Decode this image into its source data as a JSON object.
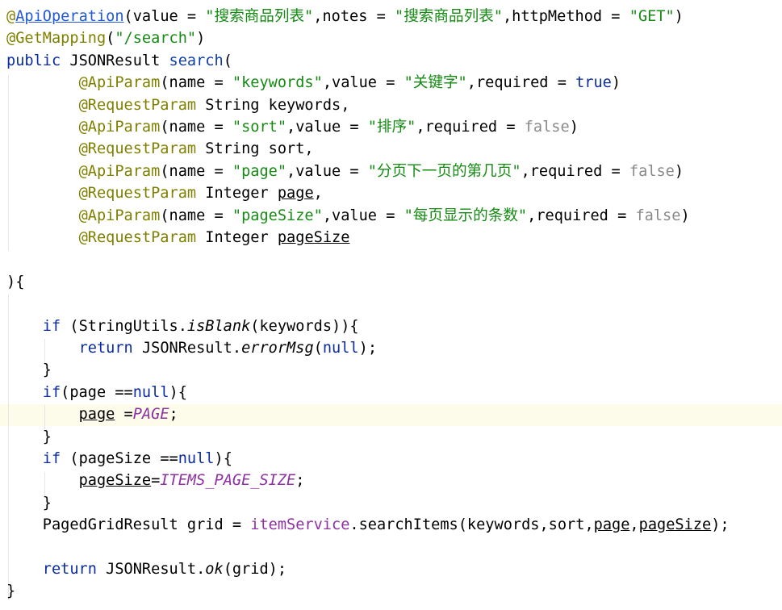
{
  "code": {
    "lines": [
      [
        {
          "t": "@",
          "c": "ann"
        },
        {
          "t": "ApiOperation",
          "c": "annu"
        },
        {
          "t": "(value = ",
          "c": ""
        },
        {
          "t": "\"搜索商品列表\"",
          "c": "str"
        },
        {
          "t": ",notes = ",
          "c": ""
        },
        {
          "t": "\"搜索商品列表\"",
          "c": "str"
        },
        {
          "t": ",httpMethod = ",
          "c": ""
        },
        {
          "t": "\"GET\"",
          "c": "str"
        },
        {
          "t": ")",
          "c": ""
        }
      ],
      [
        {
          "t": "@GetMapping",
          "c": "ann"
        },
        {
          "t": "(",
          "c": ""
        },
        {
          "t": "\"/search\"",
          "c": "str"
        },
        {
          "t": ")",
          "c": ""
        }
      ],
      [
        {
          "t": "public ",
          "c": "kw"
        },
        {
          "t": "JSONResult ",
          "c": ""
        },
        {
          "t": "search",
          "c": "meth"
        },
        {
          "t": "(",
          "c": ""
        }
      ],
      [
        {
          "t": "        ",
          "c": ""
        },
        {
          "t": "@ApiParam",
          "c": "ann"
        },
        {
          "t": "(name = ",
          "c": ""
        },
        {
          "t": "\"keywords\"",
          "c": "str"
        },
        {
          "t": ",value = ",
          "c": ""
        },
        {
          "t": "\"关键字\"",
          "c": "str"
        },
        {
          "t": ",required = ",
          "c": ""
        },
        {
          "t": "true",
          "c": "tru"
        },
        {
          "t": ")",
          "c": ""
        }
      ],
      [
        {
          "t": "        ",
          "c": ""
        },
        {
          "t": "@RequestParam ",
          "c": "ann"
        },
        {
          "t": "String keywords,",
          "c": ""
        }
      ],
      [
        {
          "t": "        ",
          "c": ""
        },
        {
          "t": "@ApiParam",
          "c": "ann"
        },
        {
          "t": "(name = ",
          "c": ""
        },
        {
          "t": "\"sort\"",
          "c": "str"
        },
        {
          "t": ",value = ",
          "c": ""
        },
        {
          "t": "\"排序\"",
          "c": "str"
        },
        {
          "t": ",required = ",
          "c": ""
        },
        {
          "t": "false",
          "c": "fal"
        },
        {
          "t": ")",
          "c": ""
        }
      ],
      [
        {
          "t": "        ",
          "c": ""
        },
        {
          "t": "@RequestParam ",
          "c": "ann"
        },
        {
          "t": "String sort,",
          "c": ""
        }
      ],
      [
        {
          "t": "        ",
          "c": ""
        },
        {
          "t": "@ApiParam",
          "c": "ann"
        },
        {
          "t": "(name = ",
          "c": ""
        },
        {
          "t": "\"page\"",
          "c": "str"
        },
        {
          "t": ",value = ",
          "c": ""
        },
        {
          "t": "\"分页下一页的第几页\"",
          "c": "str"
        },
        {
          "t": ",required = ",
          "c": ""
        },
        {
          "t": "false",
          "c": "fal"
        },
        {
          "t": ")",
          "c": ""
        }
      ],
      [
        {
          "t": "        ",
          "c": ""
        },
        {
          "t": "@RequestParam ",
          "c": "ann"
        },
        {
          "t": "Integer ",
          "c": ""
        },
        {
          "t": "page",
          "c": "ul"
        },
        {
          "t": ",",
          "c": ""
        }
      ],
      [
        {
          "t": "        ",
          "c": ""
        },
        {
          "t": "@ApiParam",
          "c": "ann"
        },
        {
          "t": "(name = ",
          "c": ""
        },
        {
          "t": "\"pageSize\"",
          "c": "str"
        },
        {
          "t": ",value = ",
          "c": ""
        },
        {
          "t": "\"每页显示的条数\"",
          "c": "str"
        },
        {
          "t": ",required = ",
          "c": ""
        },
        {
          "t": "false",
          "c": "fal"
        },
        {
          "t": ")",
          "c": ""
        }
      ],
      [
        {
          "t": "        ",
          "c": ""
        },
        {
          "t": "@RequestParam ",
          "c": "ann"
        },
        {
          "t": "Integer ",
          "c": ""
        },
        {
          "t": "pageSize",
          "c": "ul"
        }
      ],
      [],
      [
        {
          "t": "){",
          "c": ""
        }
      ],
      [],
      [
        {
          "t": "    ",
          "c": ""
        },
        {
          "t": "if ",
          "c": "kw"
        },
        {
          "t": "(StringUtils.",
          "c": ""
        },
        {
          "t": "isBlank",
          "c": "ital"
        },
        {
          "t": "(keywords)){",
          "c": ""
        }
      ],
      [
        {
          "t": "        ",
          "c": ""
        },
        {
          "t": "return ",
          "c": "kw"
        },
        {
          "t": "JSONResult.",
          "c": ""
        },
        {
          "t": "errorMsg",
          "c": "ital"
        },
        {
          "t": "(",
          "c": ""
        },
        {
          "t": "null",
          "c": "kw"
        },
        {
          "t": ");",
          "c": ""
        }
      ],
      [
        {
          "t": "    }",
          "c": ""
        }
      ],
      [
        {
          "t": "    ",
          "c": ""
        },
        {
          "t": "if",
          "c": "kw"
        },
        {
          "t": "(page ==",
          "c": ""
        },
        {
          "t": "null",
          "c": "kw"
        },
        {
          "t": "){",
          "c": ""
        }
      ],
      [
        {
          "t": "        ",
          "c": ""
        },
        {
          "t": "page",
          "c": "ul"
        },
        {
          "t": " =",
          "c": ""
        },
        {
          "t": "PAGE",
          "c": "const"
        },
        {
          "t": ";",
          "c": ""
        }
      ],
      [
        {
          "t": "    }",
          "c": ""
        }
      ],
      [
        {
          "t": "    ",
          "c": ""
        },
        {
          "t": "if ",
          "c": "kw"
        },
        {
          "t": "(pageSize ==",
          "c": ""
        },
        {
          "t": "null",
          "c": "kw"
        },
        {
          "t": "){",
          "c": ""
        }
      ],
      [
        {
          "t": "        ",
          "c": ""
        },
        {
          "t": "pageSize",
          "c": "ul"
        },
        {
          "t": "=",
          "c": ""
        },
        {
          "t": "ITEMS_PAGE_SIZE",
          "c": "const"
        },
        {
          "t": ";",
          "c": ""
        }
      ],
      [
        {
          "t": "    }",
          "c": ""
        }
      ],
      [
        {
          "t": "    PagedGridResult grid = ",
          "c": ""
        },
        {
          "t": "itemService",
          "c": "field"
        },
        {
          "t": ".searchItems(keywords,sort,",
          "c": ""
        },
        {
          "t": "page",
          "c": "ul"
        },
        {
          "t": ",",
          "c": ""
        },
        {
          "t": "pageSize",
          "c": "ul"
        },
        {
          "t": ");",
          "c": ""
        }
      ],
      [],
      [
        {
          "t": "    ",
          "c": ""
        },
        {
          "t": "return ",
          "c": "kw"
        },
        {
          "t": "JSONResult.",
          "c": ""
        },
        {
          "t": "ok",
          "c": "ital"
        },
        {
          "t": "(grid);",
          "c": ""
        }
      ],
      [
        {
          "t": "}",
          "c": ""
        }
      ]
    ],
    "caret_line": 18
  }
}
